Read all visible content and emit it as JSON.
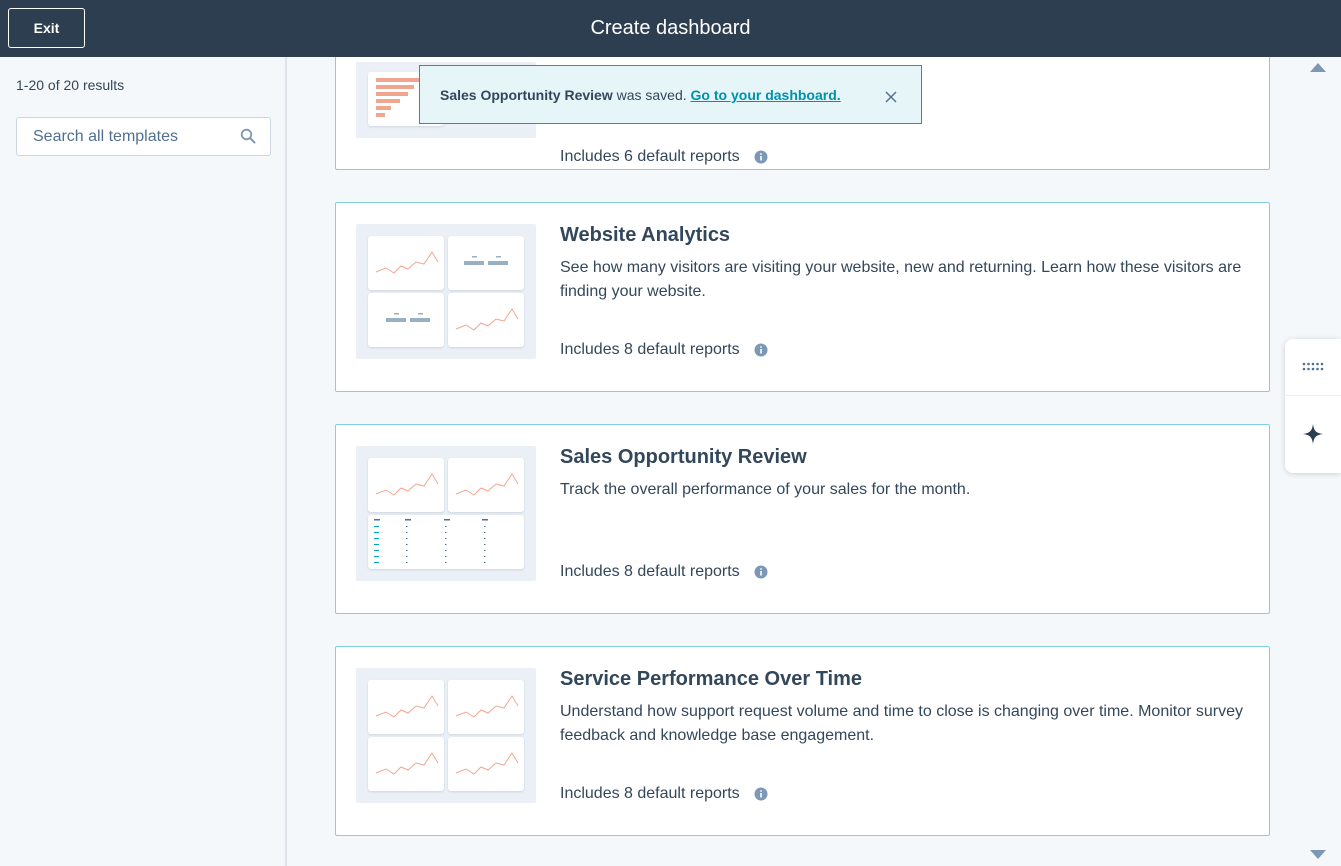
{
  "header": {
    "exit_label": "Exit",
    "title": "Create dashboard"
  },
  "sidebar": {
    "results_count": "1-20 of 20 results",
    "search_placeholder": "Search all templates"
  },
  "toast": {
    "dashboard_name": "Sales Opportunity Review",
    "saved_text": " was saved. ",
    "link_label": "Go to your dashboard."
  },
  "templates": [
    {
      "title": "",
      "description": "",
      "reports": "Includes 6 default reports"
    },
    {
      "title": "Website Analytics",
      "description": "See how many visitors are visiting your website, new and returning. Learn how these visitors are finding your website.",
      "reports": "Includes 8 default reports"
    },
    {
      "title": "Sales Opportunity Review",
      "description": "Track the overall performance of your sales for the month.",
      "reports": "Includes 8 default reports"
    },
    {
      "title": "Service Performance Over Time",
      "description": "Understand how support request volume and time to close is changing over time. Monitor survey feedback and knowledge base engagement.",
      "reports": "Includes 8 default reports"
    }
  ],
  "icons": {
    "search": "search-icon",
    "info": "info-icon",
    "close": "close-icon",
    "grid": "grid-icon",
    "sparkle": "sparkle-icon"
  },
  "colors": {
    "header_bg": "#2d3e50",
    "card_border": "#7fd1de",
    "chart_line": "#f2a58e",
    "link": "#0091ae"
  }
}
